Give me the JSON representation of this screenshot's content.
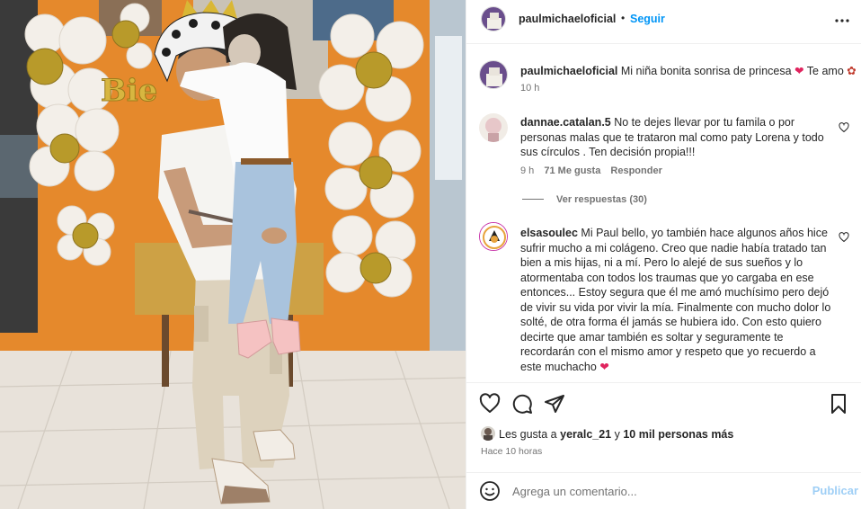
{
  "post": {
    "author": "paulmichaeloficial",
    "follow_label": "Seguir",
    "dot": "•",
    "image_banner_text": "Bie"
  },
  "caption": {
    "username": "paulmichaeloficial",
    "text": "Mi niña bonita sonrisa de princesa",
    "text_tail": "Te amo",
    "time": "10 h"
  },
  "comments": [
    {
      "username": "dannae.catalan.5",
      "text": "No te dejes llevar por tu famila o por personas malas que te trataron mal como paty Lorena y todo sus círculos . Ten decisión propia!!!",
      "time": "9 h",
      "likes": "71 Me gusta",
      "reply": "Responder",
      "view_replies": "Ver respuestas (30)"
    },
    {
      "username": "elsasoulec",
      "text": "Mi Paul bello, yo también hace algunos años hice sufrir mucho a mi colágeno. Creo que nadie había tratado tan bien a mis hijas, ni a mí. Pero lo alejé de sus sueños y lo atormentaba con todos los traumas que yo cargaba en ese entonces... Estoy segura que él me amó muchísimo pero dejó de vivir su vida por vivir la mía. Finalmente con mucho dolor lo solté, de otra forma él jamás se hubiera ido. Con esto quiero decirte que amar también es soltar y seguramente te recordarán con el mismo amor y respeto que yo recuerdo a este muchacho"
    }
  ],
  "likes_summary": {
    "prefix": "Les gusta a",
    "user": "yeralc_21",
    "joiner": "y",
    "others": "10 mil personas más"
  },
  "posted_ago": "Hace 10 horas",
  "add_comment": {
    "placeholder": "Agrega un comentario...",
    "publish_label": "Publicar"
  },
  "icons": [
    "more-options-icon",
    "heart-icon",
    "comment-icon",
    "share-icon",
    "save-icon",
    "emoji-icon",
    "red-heart-emoji",
    "rose-emoji"
  ],
  "colors": {
    "link": "#0095f6",
    "publish_disabled": "#9fcff6",
    "muted": "#737373",
    "heart": "#e0245e"
  }
}
